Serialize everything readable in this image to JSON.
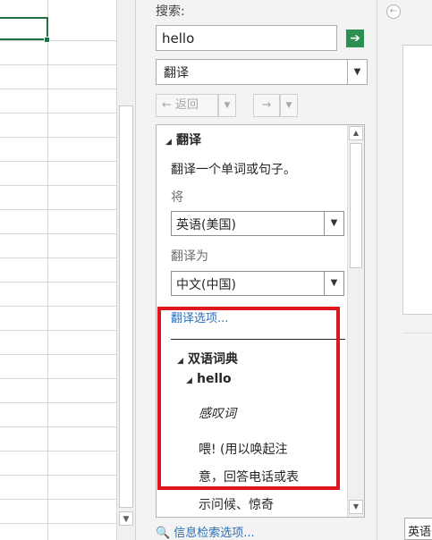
{
  "pane": {
    "search_label": "搜索:",
    "search_value": "hello",
    "service_value": "翻译",
    "back_label": "返回"
  },
  "results": {
    "translate_head": "翻译",
    "translate_desc": "翻译一个单词或句子。",
    "from_label": "将",
    "from_value": "英语(美国)",
    "to_label": "翻译为",
    "to_value": "中文(中国)",
    "options_link": "翻译选项...",
    "dict_head": "双语词典",
    "word": "hello",
    "pos": "感叹词",
    "def_line1": "喂! (用以唤起注",
    "def_line2": "意，回答电话或表",
    "def_line3": "示问候、惊奇"
  },
  "footer": {
    "research_options": "信息检索选项..."
  },
  "right": {
    "lang_value": "英语"
  },
  "colors": {
    "go_button": "#2e8f52",
    "link": "#2e6fb6",
    "highlight_box": "#e0161d",
    "cell_selection": "#217346"
  }
}
